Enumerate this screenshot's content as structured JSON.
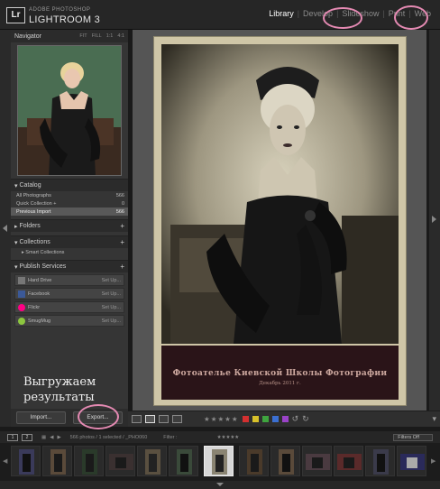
{
  "app": {
    "vendor": "ADOBE PHOTOSHOP",
    "product": "LIGHTROOM 3",
    "badge": "Lr"
  },
  "modules": [
    "Library",
    "Develop",
    "Slideshow",
    "Print",
    "Web"
  ],
  "navigator": {
    "title": "Navigator",
    "options": [
      "FIT",
      "FILL",
      "1:1",
      "4:1"
    ]
  },
  "catalog": {
    "title": "Catalog",
    "items": [
      {
        "label": "All Photographs",
        "count": "566"
      },
      {
        "label": "Quick Collection +",
        "count": "0"
      },
      {
        "label": "Previous Import",
        "count": "566"
      }
    ]
  },
  "folders": {
    "title": "Folders"
  },
  "collections": {
    "title": "Collections",
    "items": [
      "Smart Collections"
    ]
  },
  "publish": {
    "title": "Publish Services",
    "services": [
      {
        "name": "Hard Drive",
        "action": "Set Up...",
        "icon": "hard-drive-icon",
        "color": "#777777"
      },
      {
        "name": "Facebook",
        "action": "Set Up...",
        "icon": "facebook-icon",
        "color": "#3b5998"
      },
      {
        "name": "Flickr",
        "action": "Set Up...",
        "icon": "flickr-icon",
        "color": "#ff0084"
      },
      {
        "name": "SmugMug",
        "action": "Set Up...",
        "icon": "smugmug-icon",
        "color": "#8cc63f"
      }
    ]
  },
  "annotation": "Выгружаем\nрезультаты",
  "buttons": {
    "import": "Import...",
    "export": "Export..."
  },
  "photo": {
    "caption_line1": "Фотоателье Киевской Школы Фотографии",
    "caption_line2": "Декабрь 2011 г."
  },
  "toolbar": {
    "stars": "★★★★★",
    "colors": [
      "#d33030",
      "#d8c12a",
      "#3fa53f",
      "#3b6fd1",
      "#9a43c8"
    ]
  },
  "filmstrip_bar": {
    "monitors": [
      "1",
      "2"
    ],
    "path": "566 photos / 1 selected / _PHO060",
    "filter_label": "Filter :",
    "filter_value": "Filters Off"
  },
  "colors": {
    "accent_circle": "#e58ab3"
  }
}
